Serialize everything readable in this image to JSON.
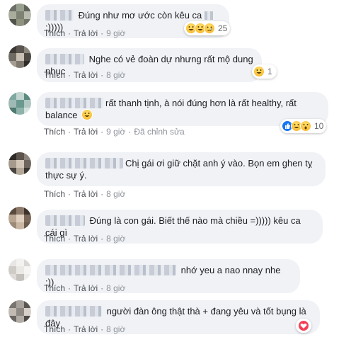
{
  "action_labels": {
    "like": "Thích",
    "reply": "Trả lời",
    "edited": "Đã chỉnh sửa",
    "dot": "·"
  },
  "comments": [
    {
      "text": "Đúng như mơ ước còn kêu ca",
      "text_suffix": ":)))))",
      "time": "9 giờ",
      "reactions": [
        "haha-icon",
        "haha-icon",
        "sad-icon"
      ],
      "reaction_count": "25"
    },
    {
      "text": "Nghe có vẻ đoàn dự nhưng rất mộ dung phục",
      "time": "8 giờ",
      "reactions": [
        "haha-icon"
      ],
      "reaction_count": "1"
    },
    {
      "text_line1": "rất thanh tịnh, à nói đúng hơn là rất healthy, rất",
      "text_line2": "balance",
      "time": "9 giờ",
      "edited": true,
      "reactions": [
        "like-icon",
        "haha-icon",
        "wow-icon"
      ],
      "reaction_count": "10"
    },
    {
      "text_line1": "Chị gái ơi giữ chặt anh ý vào. Bọn em ghen tỵ",
      "text_line2": "thực sự ý.",
      "time": "8 giờ"
    },
    {
      "text": "Đúng là con gái. Biết thế nào mà chiều =))))) kêu ca cái gì",
      "time": "8 giờ"
    },
    {
      "text": "nhớ yeu a nao nnay nhe :))",
      "time": "8 giờ"
    },
    {
      "text": "người đàn ông thật thà + đang yêu và tốt bụng là đây",
      "time": "8 giờ",
      "reactions": [
        "love-icon"
      ],
      "reaction_count": ""
    }
  ],
  "colors": {
    "bubble": "#f0f2f5",
    "text": "#1c1e21",
    "action": "#65676b",
    "like": "#1877f2",
    "love": "#f33e58",
    "haha": "#f7b125"
  }
}
